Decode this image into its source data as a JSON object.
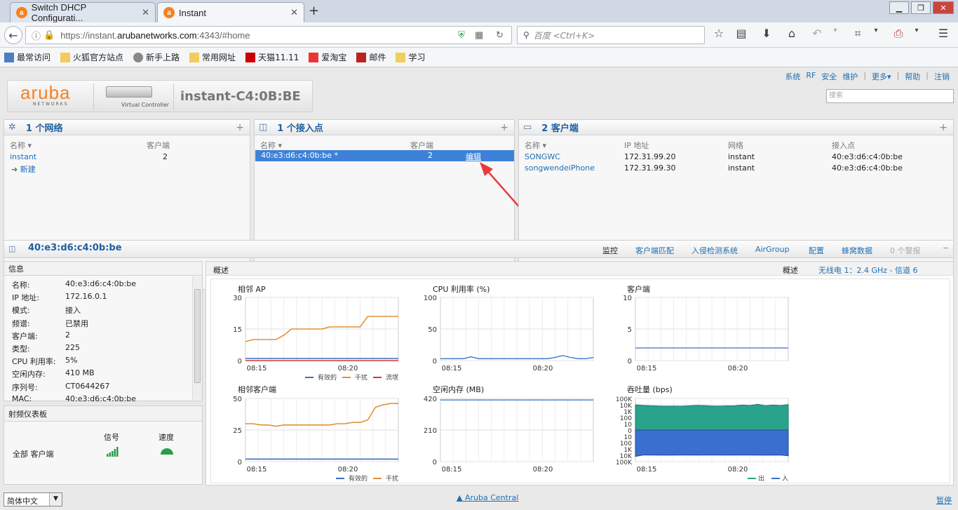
{
  "browser": {
    "tabs": [
      {
        "title": "Switch DHCP Configurati...",
        "close": "✕"
      },
      {
        "title": "Instant",
        "close": "✕"
      }
    ],
    "newtab": "+",
    "url_pre": "https://instant.",
    "url_host": "arubanetworks.com",
    "url_post": ":4343/#home",
    "search_placeholder": "百度 <Ctrl+K>",
    "bookmarks": [
      "最常访问",
      "火狐官方站点",
      "新手上路",
      "常用网址",
      "天猫11.11",
      "爱淘宝",
      "邮件",
      "学习"
    ]
  },
  "toplinks": [
    "系统",
    "RF",
    "安全",
    "维护",
    "更多▾",
    "帮助",
    "注销"
  ],
  "logo": {
    "brand": "aruba",
    "brand_sub": "NETWORKS",
    "device_caption": "Virtual Controller",
    "title": "instant-C4:0B:BE"
  },
  "search_placeholder": "搜索",
  "networks": {
    "title": "1 个网络",
    "col_name": "名称 ▾",
    "col_clients": "客户端",
    "rows": [
      {
        "name": "instant",
        "clients": "2"
      }
    ],
    "new_label": "新建"
  },
  "aps": {
    "title": "1 个接入点",
    "col_name": "名称 ▾",
    "col_clients": "客户端",
    "rows": [
      {
        "name": "40:e3:d6:c4:0b:be *",
        "clients": "2",
        "action": "编辑"
      }
    ]
  },
  "clients": {
    "title": "2 客户端",
    "cols": [
      "名称 ▾",
      "IP 地址",
      "网络",
      "接入点"
    ],
    "rows": [
      {
        "name": "SONGWC",
        "ip": "172.31.99.20",
        "net": "instant",
        "ap": "40:e3:d6:c4:0b:be"
      },
      {
        "name": "songwendeiPhone",
        "ip": "172.31.99.30",
        "net": "instant",
        "ap": "40:e3:d6:c4:0b:be"
      }
    ]
  },
  "detail": {
    "title": "40:e3:d6:c4:0b:be",
    "tabs": [
      "监控",
      "客户端匹配",
      "入侵检测系统",
      "AirGroup",
      "配置",
      "蜂窝数据",
      "0 个警报"
    ],
    "collapse": "−"
  },
  "info": {
    "title": "信息",
    "rows": [
      [
        "名称:",
        "40:e3:d6:c4:0b:be"
      ],
      [
        "IP 地址:",
        "172.16.0.1"
      ],
      [
        "模式:",
        "接入"
      ],
      [
        "频谱:",
        "已禁用"
      ],
      [
        "客户端:",
        "2"
      ],
      [
        "类型:",
        "225"
      ],
      [
        "CPU 利用率:",
        "5%"
      ],
      [
        "空闲内存:",
        "410 MB"
      ],
      [
        "序列号:",
        "CT0644267"
      ],
      [
        "MAC:",
        "40:e3:d6:c4:0b:be"
      ]
    ]
  },
  "rf": {
    "title": "射频仪表板",
    "col_signal": "信号",
    "col_speed": "速度",
    "row_label": "全部 客户端"
  },
  "overview": {
    "title": "概述",
    "right_label": "概述",
    "radio": "无线电 1：2.4 GHz - 信道 6"
  },
  "footer": {
    "lang": "简体中文",
    "central": "Aruba Central",
    "pause": "暂停"
  },
  "chart_data": [
    {
      "type": "line",
      "title": "相邻 AP",
      "x": [
        "08:15",
        "08:20"
      ],
      "ylim": [
        0,
        30
      ],
      "yticks": [
        "30",
        "15",
        "0"
      ],
      "series": [
        {
          "name": "有效的",
          "color": "#3a6fc4",
          "values": [
            1,
            1,
            1,
            1,
            1,
            1,
            1,
            1,
            1,
            1,
            1,
            1,
            1,
            1,
            1,
            1,
            1,
            1,
            1,
            1,
            1
          ]
        },
        {
          "name": "干扰",
          "color": "#e0913a",
          "values": [
            9,
            10,
            10,
            10,
            10,
            12,
            15,
            15,
            15,
            15,
            15,
            16,
            16,
            16,
            16,
            16,
            21,
            21,
            21,
            21,
            21
          ]
        },
        {
          "name": "流氓",
          "color": "#d33",
          "values": [
            0,
            0,
            0,
            0,
            0,
            0,
            0,
            0,
            0,
            0,
            0,
            0,
            0,
            0,
            0,
            0,
            0,
            0,
            0,
            0,
            0
          ]
        }
      ]
    },
    {
      "type": "line",
      "title": "CPU 利用率  (%)",
      "x": [
        "08:15",
        "08:20"
      ],
      "ylim": [
        0,
        100
      ],
      "yticks": [
        "100",
        "50",
        "0"
      ],
      "series": [
        {
          "name": "",
          "color": "#3a6fc4",
          "values": [
            3,
            3,
            3,
            3,
            6,
            3,
            3,
            3,
            3,
            3,
            3,
            3,
            3,
            3,
            3,
            5,
            8,
            5,
            3,
            3,
            5
          ]
        }
      ]
    },
    {
      "type": "line",
      "title": "客户端",
      "x": [
        "08:15",
        "08:20"
      ],
      "ylim": [
        0,
        10
      ],
      "yticks": [
        "10",
        "5",
        "0"
      ],
      "series": [
        {
          "name": "",
          "color": "#3a6fc4",
          "values": [
            2,
            2,
            2,
            2,
            2,
            2,
            2,
            2,
            2,
            2,
            2,
            2,
            2,
            2,
            2,
            2,
            2,
            2,
            2,
            2,
            2
          ]
        }
      ]
    },
    {
      "type": "line",
      "title": "相邻客户端",
      "x": [
        "08:15",
        "08:20"
      ],
      "ylim": [
        0,
        50
      ],
      "yticks": [
        "50",
        "25",
        "0"
      ],
      "series": [
        {
          "name": "有效的",
          "color": "#3a6fc4",
          "values": [
            2,
            2,
            2,
            2,
            2,
            2,
            2,
            2,
            2,
            2,
            2,
            2,
            2,
            2,
            2,
            2,
            2,
            2,
            2,
            2,
            2
          ]
        },
        {
          "name": "干扰",
          "color": "#e0913a",
          "values": [
            30,
            30,
            29,
            29,
            28,
            29,
            29,
            29,
            29,
            29,
            29,
            29,
            30,
            30,
            31,
            31,
            33,
            43,
            45,
            46,
            46
          ]
        }
      ]
    },
    {
      "type": "line",
      "title": "空闲内存  (MB)",
      "x": [
        "08:15",
        "08:20"
      ],
      "ylim": [
        0,
        420
      ],
      "yticks": [
        "420",
        "210",
        "0"
      ],
      "series": [
        {
          "name": "",
          "color": "#3a6fc4",
          "values": [
            410,
            410,
            410,
            410,
            410,
            410,
            410,
            410,
            410,
            410,
            410,
            410,
            410,
            410,
            410,
            410,
            410,
            410,
            410,
            410,
            410
          ]
        }
      ]
    },
    {
      "type": "area",
      "title": "吞吐量  (bps)",
      "x": [
        "08:15",
        "08:20"
      ],
      "yticks": [
        "100K",
        "10K",
        "1K",
        "100",
        "10",
        "0",
        "10",
        "100",
        "1K",
        "10K",
        "100K"
      ],
      "series": [
        {
          "name": "出",
          "color": "#2aa38c",
          "values": [
            10000,
            8000,
            7000,
            6500,
            6000,
            6200,
            6000,
            6800,
            8000,
            7500,
            6500,
            6200,
            6800,
            7000,
            9000,
            7500,
            12000,
            7000,
            9000,
            7500,
            11000
          ]
        },
        {
          "name": "入",
          "color": "#3a6fd0",
          "values": [
            15000,
            9000,
            9000,
            9500,
            9000,
            9200,
            9000,
            9000,
            9300,
            9000,
            9000,
            9000,
            9200,
            9000,
            9000,
            9000,
            9500,
            9000,
            9500,
            9000,
            12000
          ]
        }
      ]
    }
  ]
}
